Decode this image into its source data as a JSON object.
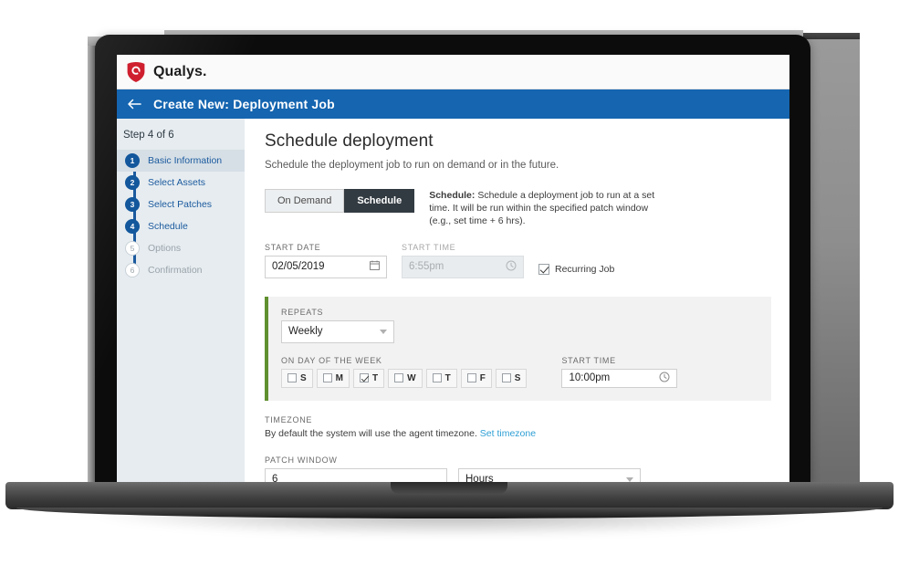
{
  "brand": {
    "name": "Qualys.",
    "logo_icon": "qualys-shield-logo",
    "logo_color": "#cf1f2e"
  },
  "topbar": {
    "back_icon": "back-arrow-icon",
    "title": "Create New: Deployment Job",
    "bg": "#1565b0"
  },
  "sidebar": {
    "step_of": "Step 4 of 6",
    "items": [
      {
        "num": "1",
        "label": "Basic Information",
        "state": "done",
        "highlighted": true
      },
      {
        "num": "2",
        "label": "Select Assets",
        "state": "done",
        "highlighted": false
      },
      {
        "num": "3",
        "label": "Select Patches",
        "state": "done",
        "highlighted": false
      },
      {
        "num": "4",
        "label": "Schedule",
        "state": "done",
        "highlighted": false
      },
      {
        "num": "5",
        "label": "Options",
        "state": "todo",
        "highlighted": false
      },
      {
        "num": "6",
        "label": "Confirmation",
        "state": "todo",
        "highlighted": false
      }
    ]
  },
  "main": {
    "title": "Schedule deployment",
    "subtitle": "Schedule the deployment job to run on demand or in the future.",
    "mode": {
      "on_demand_label": "On Demand",
      "schedule_label": "Schedule",
      "active": "Schedule",
      "desc_strong": "Schedule:",
      "desc_text": " Schedule a deployment job to run at a set time. It will be run within the specified patch window (e.g., set time + 6 hrs)."
    },
    "start_date": {
      "label": "START DATE",
      "value": "02/05/2019",
      "icon": "calendar-icon"
    },
    "start_time": {
      "label": "START TIME",
      "value": "6:55pm",
      "icon": "clock-icon",
      "disabled": true
    },
    "recurring": {
      "label": "Recurring Job",
      "checked": true
    },
    "repeats": {
      "label": "REPEATS",
      "value": "Weekly",
      "caret_icon": "chevron-down-icon",
      "accent_color": "#5f8f2e",
      "dow_label": "ON DAY OF THE WEEK",
      "days": [
        {
          "letter": "S",
          "checked": false
        },
        {
          "letter": "M",
          "checked": false
        },
        {
          "letter": "T",
          "checked": true
        },
        {
          "letter": "W",
          "checked": false
        },
        {
          "letter": "T",
          "checked": false
        },
        {
          "letter": "F",
          "checked": false
        },
        {
          "letter": "S",
          "checked": false
        }
      ],
      "start_time_label": "START TIME",
      "start_time_value": "10:00pm",
      "start_time_icon": "clock-icon"
    },
    "timezone": {
      "label": "TIMEZONE",
      "text": "By default the system will use the agent timezone.",
      "link": "Set timezone"
    },
    "patch_window": {
      "label": "PATCH WINDOW",
      "amount": "6",
      "unit": "Hours",
      "caret_icon": "chevron-down-icon"
    }
  }
}
